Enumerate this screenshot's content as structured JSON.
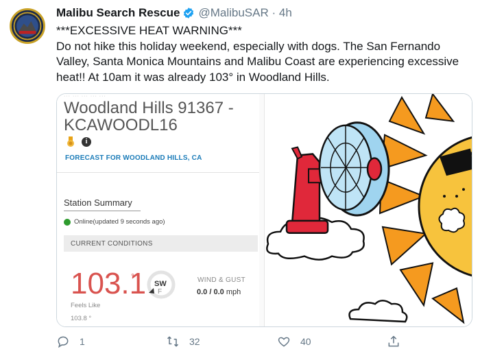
{
  "tweet": {
    "author_name": "Malibu Search Rescue",
    "handle_time": "@MalibuSAR · 4h",
    "text": "***EXCESSIVE HEAT WARNING***\nDo not hike this holiday weekend, especially with dogs. The San Fernando Valley, Santa Monica Mountains and Malibu Coast are experiencing excessive heat!!  At 10am it was already 103° in Woodland Hills."
  },
  "card": {
    "station_name": "Woodland Hills 91367 - KCAWOODL16",
    "forecast_link": "FORECAST FOR WOODLAND HILLS, CA",
    "summary_title": "Station Summary",
    "status": "Online(updated 9 seconds ago)",
    "current_conditions_label": "CURRENT CONDITIONS",
    "temperature": "103.1",
    "degree_symbol": "°",
    "wind_direction": "SW",
    "wind_unit_symbol": "F",
    "wind_gust_label": "WIND & GUST",
    "wind_value": "0.0",
    "gust_value": "/ 0.0",
    "wind_unit": "mph",
    "feels_like_label": "Feels Like",
    "feels_like_value": "103.8 °"
  },
  "actions": {
    "replies": "1",
    "retweets": "32",
    "likes": "40"
  },
  "colors": {
    "verified_blue": "#1da1f2",
    "temp_red": "#d9534f",
    "link_blue": "#1a7bb8",
    "muted_gray": "#657786",
    "online_green": "#2e9b2e",
    "sun_orange": "#f59a1f",
    "fan_red": "#e0283a",
    "fan_blue": "#9fd4ef"
  },
  "icons": [
    "verified-badge-icon",
    "medal-icon",
    "info-icon",
    "reply-icon",
    "retweet-icon",
    "like-icon",
    "share-icon"
  ]
}
